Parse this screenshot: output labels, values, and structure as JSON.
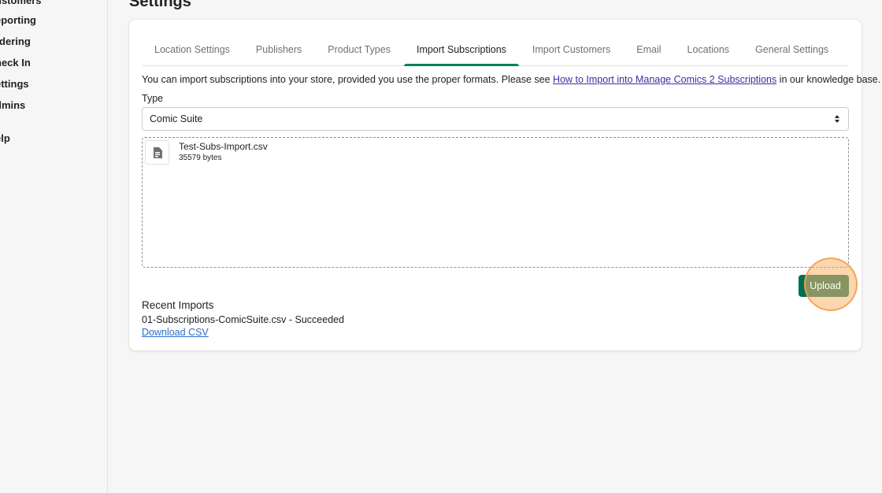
{
  "sidebar": {
    "items": [
      {
        "label": "ustomers"
      },
      {
        "label": "eporting"
      },
      {
        "label": "rdering"
      },
      {
        "label": "heck In"
      },
      {
        "label": "ettings"
      },
      {
        "label": "dmins"
      },
      {
        "label": "elp"
      }
    ]
  },
  "page": {
    "title": "Settings"
  },
  "tabs": [
    {
      "label": "Location Settings",
      "active": false
    },
    {
      "label": "Publishers",
      "active": false
    },
    {
      "label": "Product Types",
      "active": false
    },
    {
      "label": "Import Subscriptions",
      "active": true
    },
    {
      "label": "Import Customers",
      "active": false
    },
    {
      "label": "Email",
      "active": false
    },
    {
      "label": "Locations",
      "active": false
    },
    {
      "label": "General Settings",
      "active": false
    }
  ],
  "intro": {
    "before": "You can import subscriptions into your store, provided you use the proper formats. Please see ",
    "link": "How to Import into Manage Comics 2 Subscriptions",
    "after": " in our knowledge base."
  },
  "type_field": {
    "label": "Type",
    "selected": "Comic Suite"
  },
  "dropzone": {
    "file_name": "Test-Subs-Import.csv",
    "file_size": "35579 bytes",
    "file_icon": "document-icon"
  },
  "upload": {
    "label": "Upload"
  },
  "recent_imports": {
    "title": "Recent Imports",
    "item": "01-Subscriptions-ComicSuite.csv - Succeeded",
    "download_label": "Download CSV"
  },
  "colors": {
    "accent": "#008060",
    "button": "#006e52",
    "highlight": "#f7b46e",
    "link": "#2c6ecb"
  }
}
